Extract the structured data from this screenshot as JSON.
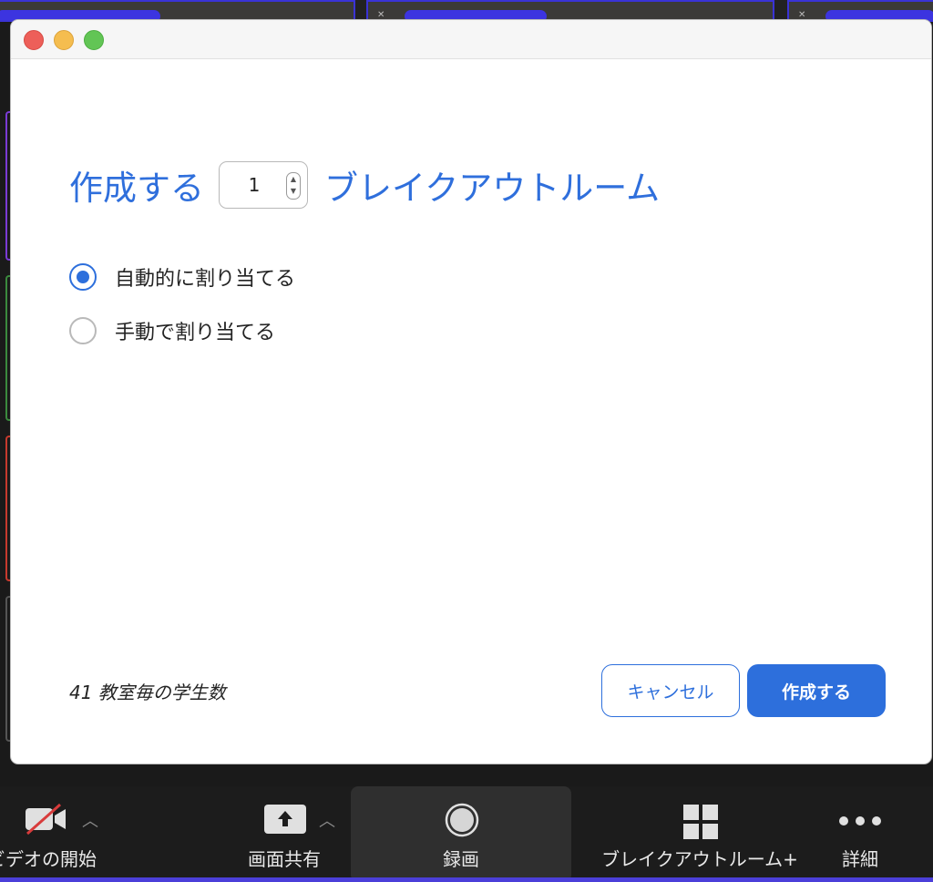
{
  "dialog": {
    "headline_prefix": "作成する",
    "room_count": "1",
    "headline_suffix": "ブレイクアウトルーム",
    "options": [
      {
        "label": "自動的に割り当てる",
        "selected": true
      },
      {
        "label": "手動で割り当てる",
        "selected": false
      }
    ],
    "students_per_room": "41 教室毎の学生数",
    "cancel_label": "キャンセル",
    "create_label": "作成する"
  },
  "toolbar": {
    "video_label": "ビデオの開始",
    "share_label": "画面共有",
    "record_label": "録画",
    "breakout_label": "ブレイクアウトルーム+",
    "more_label": "詳細"
  },
  "colors": {
    "accent": "#2d6fdc",
    "toolbar_bg": "#1c1c1c",
    "tile_border": "#3a33d6"
  }
}
